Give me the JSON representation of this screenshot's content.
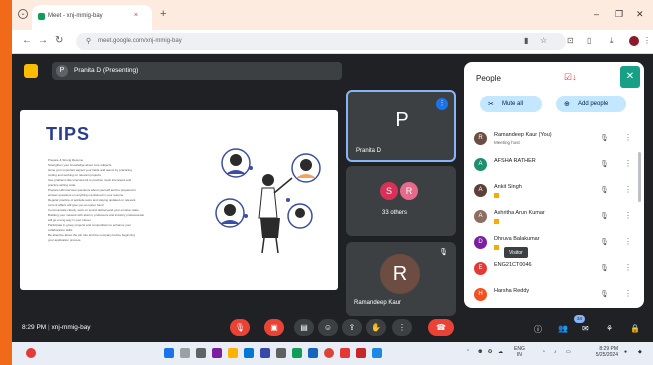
{
  "browser": {
    "tab_title": "Meet - xnj-mmig-bay",
    "url": "meet.google.com/xnj-mmig-bay",
    "new_tab": "+",
    "close_tab": "×",
    "minimize": "–",
    "restore": "❐",
    "close_window": "✕"
  },
  "meet": {
    "presenting_label": "Pranita D (Presenting)",
    "slide": {
      "title": "TIPS",
      "bullets": [
        "Prepare & Strong Resume",
        "Strengthen your knowledge about core subjects",
        "Hone your important aspect your fields and teams by practicing",
        "coding and working on relevant projects",
        "Use problems like interview kit to practice mock interviews and",
        "practice writing code.",
        "Prepare HR interview questions about yourself and be prepared to",
        "answer questions on anything mentioned in your resume.",
        "Regular practice of aptitude tests and staying updated on relevant",
        "current affairs will give you an upper hand.",
        "Communicate clearly, work on sound deliveryand your emotion state.",
        "Building your network with alumni, professors and industry professionals",
        "will go a long way in your career.",
        "Participate in group projects and competitions to enhance your",
        "collaboration skills",
        "Be attentive about the job role and the company before beginning",
        "your application process."
      ]
    },
    "tiles": [
      {
        "initial": "P",
        "name": "Pranita D",
        "color": "#5f6368"
      },
      {
        "initials": [
          "S",
          "R"
        ],
        "name": "33 others",
        "colors": [
          "#d93058",
          "#e86a8a"
        ]
      },
      {
        "initial": "R",
        "name": "Ramandeep Kaur",
        "color": "#6d4c41"
      }
    ],
    "meeting_time": "8:29 PM",
    "meeting_sep": "|",
    "meeting_code": "xnj-mmig-bay",
    "participants_count": "34"
  },
  "people_panel": {
    "title": "People",
    "close": "✕",
    "mute_all": "Mute all",
    "add_people": "Add people",
    "participants": [
      {
        "initial": "R",
        "name": "Ramandeep Kaur (You)",
        "sub": "Meeting host",
        "color": "#6d4c41"
      },
      {
        "initial": "A",
        "name": "AFSHA RATHER",
        "sub": "",
        "color": "#1e8e6e"
      },
      {
        "initial": "A",
        "name": "Ankit Singh",
        "sub": "",
        "color": "#5d4037"
      },
      {
        "initial": "A",
        "name": "Ashritha Arun Kumar",
        "sub": "",
        "color": "#8d6e63"
      },
      {
        "initial": "D",
        "name": "Dhruva Balakumar",
        "sub": "",
        "color": "#7b1fa2"
      },
      {
        "initial": "E",
        "name": "ENG21CT0046",
        "sub": "",
        "color": "#e53935"
      },
      {
        "initial": "H",
        "name": "Harsha Reddy",
        "sub": "",
        "color": "#f4511e"
      }
    ],
    "tooltip": "Visitor"
  },
  "taskbar": {
    "lang": "ENG",
    "lang_sub": "IN",
    "clock_time": "8:29 PM",
    "clock_date": "5/25/2024"
  },
  "colors": {
    "accent_blue": "#1a73e8",
    "end_call_red": "#ea4335",
    "pill_blue": "#c2e7ff",
    "meet_bg": "#202124"
  }
}
